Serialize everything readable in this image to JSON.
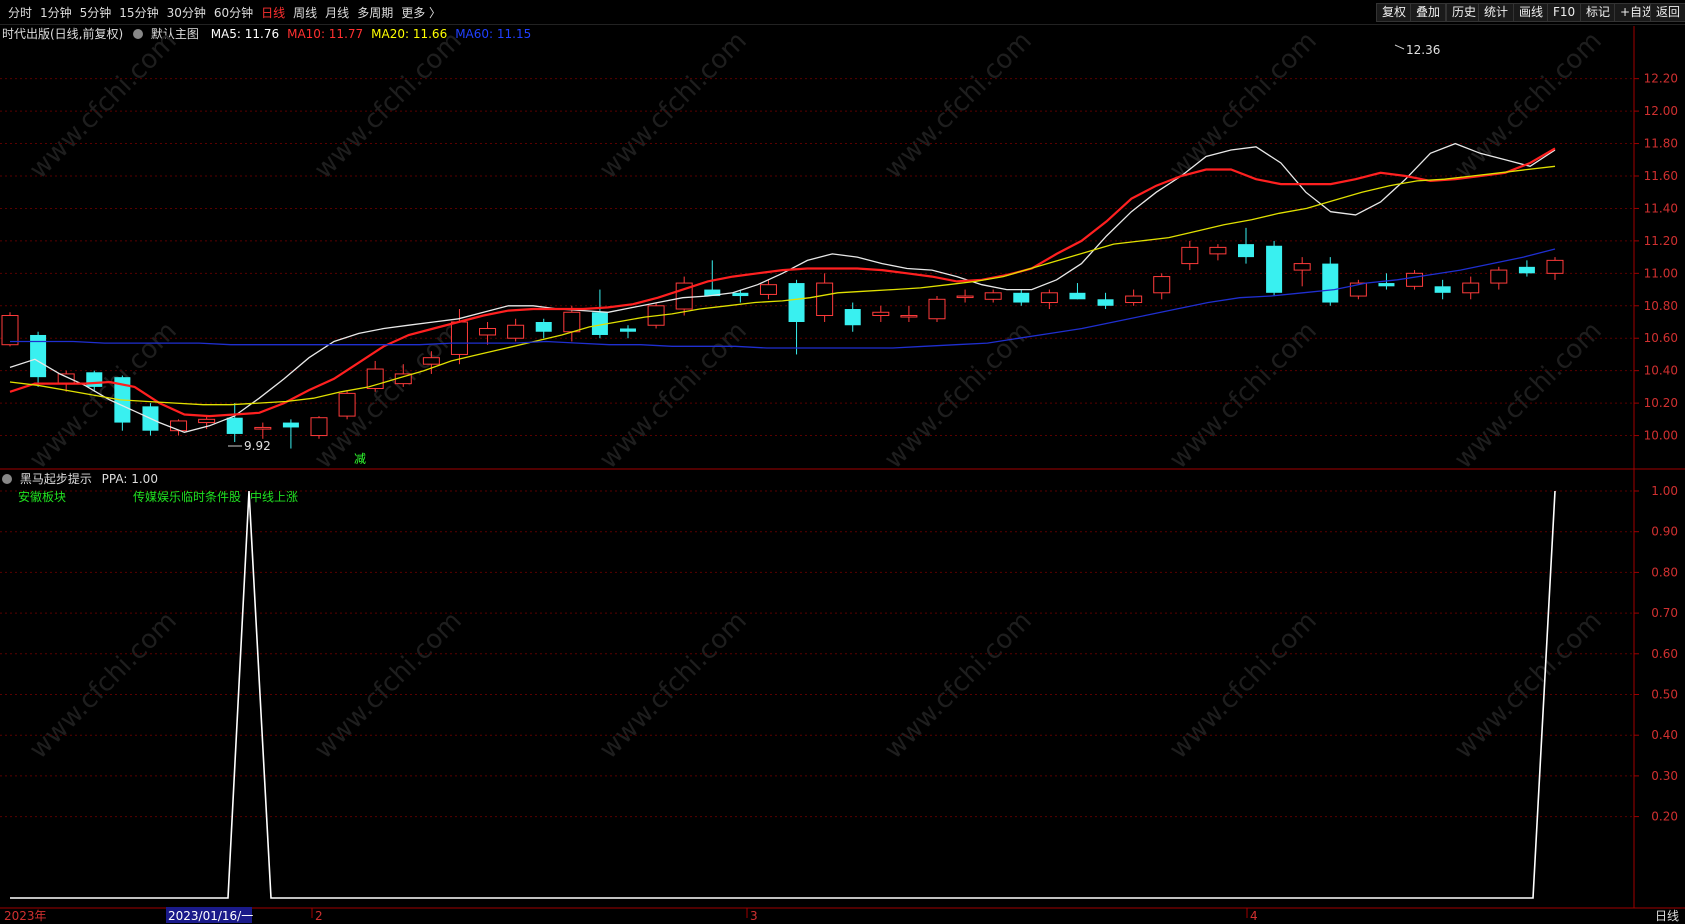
{
  "toolbar": {
    "left_tabs": [
      "分时",
      "1分钟",
      "5分钟",
      "15分钟",
      "30分钟",
      "60分钟",
      "日线",
      "周线",
      "月线",
      "多周期",
      "更多 〉"
    ],
    "active_tab": "日线",
    "right_buttons": [
      "复权",
      "叠加",
      "历史",
      "统计",
      "画线",
      "F10",
      "标记",
      "+自选",
      "返回"
    ]
  },
  "main_chart": {
    "stock_name": "时代出版(日线,前复权)",
    "indicator_label": "默认主图",
    "ma_labels": [
      {
        "text": "MA5: 11.76",
        "color": "#ffffff"
      },
      {
        "text": "MA10: 11.77",
        "color": "#ff3030"
      },
      {
        "text": "MA20: 11.66",
        "color": "#ffff00"
      },
      {
        "text": "MA60: 11.15",
        "color": "#2040ff"
      }
    ],
    "high_label": "12.36",
    "low_label": "9.92",
    "marker_text": "减",
    "y_ticks": [
      "12.20",
      "12.00",
      "11.80",
      "11.60",
      "11.40",
      "11.20",
      "11.00",
      "10.80",
      "10.60",
      "10.40",
      "10.20",
      "10.00"
    ],
    "y_range": [
      9.8,
      12.5
    ]
  },
  "sub_chart": {
    "title": "黑马起步提示",
    "value_label": "PPA: 1.00",
    "annotations": [
      "安徽板块",
      "传媒娱乐临时条件股",
      "中线上涨"
    ],
    "y_ticks": [
      "1.00",
      "0.90",
      "0.80",
      "0.70",
      "0.60",
      "0.50",
      "0.40",
      "0.30",
      "0.20"
    ]
  },
  "x_axis": {
    "labels": [
      "2023年",
      "2",
      "3",
      "4"
    ],
    "cursor_date": "2023/01/16/一",
    "period_label": "日线"
  },
  "watermark": "www.cfchi.com",
  "chart_data": {
    "type": "candlestick",
    "series": [
      {
        "name": "MA5",
        "values": [
          10.42,
          10.47,
          10.38,
          10.31,
          10.22,
          10.15,
          10.08,
          10.02,
          10.06,
          10.12,
          10.23,
          10.35,
          10.48,
          10.58,
          10.63,
          10.66,
          10.68,
          10.7,
          10.72,
          10.76,
          10.8,
          10.8,
          10.78,
          10.77,
          10.76,
          10.79,
          10.82,
          10.85,
          10.86,
          10.88,
          10.93,
          11.0,
          11.08,
          11.12,
          11.1,
          11.06,
          11.03,
          11.02,
          10.98,
          10.93,
          10.9,
          10.9,
          10.96,
          11.06,
          11.23,
          11.38,
          11.5,
          11.6,
          11.72,
          11.76,
          11.78,
          11.68,
          11.5,
          11.38,
          11.36,
          11.44,
          11.58,
          11.74,
          11.8,
          11.74,
          11.7,
          11.66,
          11.76
        ]
      },
      {
        "name": "MA10",
        "values": [
          10.27,
          10.32,
          10.32,
          10.32,
          10.33,
          10.3,
          10.2,
          10.13,
          10.12,
          10.13,
          10.14,
          10.2,
          10.28,
          10.35,
          10.45,
          10.55,
          10.62,
          10.66,
          10.7,
          10.74,
          10.77,
          10.78,
          10.78,
          10.78,
          10.79,
          10.81,
          10.85,
          10.9,
          10.95,
          10.98,
          11.0,
          11.02,
          11.03,
          11.03,
          11.03,
          11.02,
          11.0,
          10.98,
          10.95,
          10.96,
          10.99,
          11.03,
          11.12,
          11.2,
          11.32,
          11.46,
          11.54,
          11.6,
          11.64,
          11.64,
          11.58,
          11.55,
          11.55,
          11.55,
          11.58,
          11.62,
          11.6,
          11.57,
          11.58,
          11.6,
          11.62,
          11.68,
          11.77
        ]
      },
      {
        "name": "MA20",
        "values": [
          10.33,
          10.31,
          10.28,
          10.25,
          10.22,
          10.21,
          10.2,
          10.19,
          10.19,
          10.2,
          10.21,
          10.23,
          10.27,
          10.3,
          10.35,
          10.4,
          10.46,
          10.5,
          10.54,
          10.58,
          10.62,
          10.67,
          10.7,
          10.73,
          10.75,
          10.78,
          10.8,
          10.82,
          10.83,
          10.85,
          10.88,
          10.89,
          10.9,
          10.91,
          10.93,
          10.95,
          10.98,
          11.03,
          11.08,
          11.13,
          11.18,
          11.2,
          11.22,
          11.26,
          11.3,
          11.33,
          11.37,
          11.4,
          11.45,
          11.5,
          11.54,
          11.57,
          11.58,
          11.6,
          11.62,
          11.64,
          11.66
        ]
      },
      {
        "name": "MA60",
        "values": [
          10.58,
          10.58,
          10.58,
          10.57,
          10.57,
          10.57,
          10.57,
          10.56,
          10.56,
          10.56,
          10.56,
          10.56,
          10.56,
          10.56,
          10.57,
          10.57,
          10.57,
          10.58,
          10.57,
          10.56,
          10.56,
          10.55,
          10.55,
          10.55,
          10.54,
          10.54,
          10.54,
          10.54,
          10.54,
          10.55,
          10.56,
          10.57,
          10.6,
          10.63,
          10.66,
          10.7,
          10.74,
          10.78,
          10.82,
          10.85,
          10.86,
          10.88,
          10.9,
          10.94,
          10.96,
          10.99,
          11.02,
          11.06,
          11.1,
          11.15
        ]
      },
      {
        "name": "PPA",
        "values": [
          0,
          0,
          0,
          0,
          0,
          0,
          0,
          0,
          0,
          0,
          0,
          1,
          0,
          0,
          0,
          0,
          0,
          0,
          0,
          0,
          0,
          0,
          0,
          0,
          0,
          0,
          0,
          0,
          0,
          0,
          0,
          0,
          0,
          0,
          0,
          0,
          0,
          0,
          0,
          0,
          0,
          0,
          0,
          0,
          0,
          0,
          0,
          0,
          0,
          0,
          0,
          0,
          0,
          0,
          0,
          0,
          0,
          0,
          0,
          0,
          0,
          0,
          0,
          0,
          0,
          0,
          0,
          0,
          0,
          0,
          1
        ]
      }
    ],
    "candles": [
      {
        "o": 10.56,
        "h": 10.76,
        "l": 10.55,
        "c": 10.74
      },
      {
        "o": 10.62,
        "h": 10.64,
        "l": 10.3,
        "c": 10.36
      },
      {
        "o": 10.32,
        "h": 10.4,
        "l": 10.27,
        "c": 10.38
      },
      {
        "o": 10.39,
        "h": 10.4,
        "l": 10.27,
        "c": 10.3
      },
      {
        "o": 10.36,
        "h": 10.37,
        "l": 10.03,
        "c": 10.08
      },
      {
        "o": 10.18,
        "h": 10.2,
        "l": 10.0,
        "c": 10.03
      },
      {
        "o": 10.03,
        "h": 10.1,
        "l": 10.0,
        "c": 10.09
      },
      {
        "o": 10.08,
        "h": 10.12,
        "l": 10.04,
        "c": 10.1
      },
      {
        "o": 10.11,
        "h": 10.2,
        "l": 9.96,
        "c": 10.01
      },
      {
        "o": 10.04,
        "h": 10.08,
        "l": 9.98,
        "c": 10.05
      },
      {
        "o": 10.08,
        "h": 10.1,
        "l": 9.92,
        "c": 10.05
      },
      {
        "o": 10.0,
        "h": 10.12,
        "l": 9.98,
        "c": 10.11
      },
      {
        "o": 10.12,
        "h": 10.28,
        "l": 10.1,
        "c": 10.26
      },
      {
        "o": 10.29,
        "h": 10.46,
        "l": 10.27,
        "c": 10.41
      },
      {
        "o": 10.32,
        "h": 10.44,
        "l": 10.3,
        "c": 10.38
      },
      {
        "o": 10.44,
        "h": 10.52,
        "l": 10.38,
        "c": 10.48
      },
      {
        "o": 10.5,
        "h": 10.78,
        "l": 10.44,
        "c": 10.7
      },
      {
        "o": 10.62,
        "h": 10.7,
        "l": 10.56,
        "c": 10.66
      },
      {
        "o": 10.6,
        "h": 10.72,
        "l": 10.58,
        "c": 10.68
      },
      {
        "o": 10.7,
        "h": 10.72,
        "l": 10.6,
        "c": 10.64
      },
      {
        "o": 10.64,
        "h": 10.8,
        "l": 10.58,
        "c": 10.76
      },
      {
        "o": 10.76,
        "h": 10.9,
        "l": 10.6,
        "c": 10.62
      },
      {
        "o": 10.66,
        "h": 10.68,
        "l": 10.6,
        "c": 10.64
      },
      {
        "o": 10.68,
        "h": 10.82,
        "l": 10.66,
        "c": 10.8
      },
      {
        "o": 10.78,
        "h": 10.98,
        "l": 10.74,
        "c": 10.94
      },
      {
        "o": 10.9,
        "h": 11.08,
        "l": 10.86,
        "c": 10.86
      },
      {
        "o": 10.88,
        "h": 10.9,
        "l": 10.82,
        "c": 10.86
      },
      {
        "o": 10.87,
        "h": 10.96,
        "l": 10.84,
        "c": 10.93
      },
      {
        "o": 10.94,
        "h": 10.96,
        "l": 10.5,
        "c": 10.7
      },
      {
        "o": 10.74,
        "h": 11.0,
        "l": 10.7,
        "c": 10.94
      },
      {
        "o": 10.78,
        "h": 10.82,
        "l": 10.64,
        "c": 10.68
      },
      {
        "o": 10.74,
        "h": 10.8,
        "l": 10.7,
        "c": 10.76
      },
      {
        "o": 10.74,
        "h": 10.8,
        "l": 10.7,
        "c": 10.74
      },
      {
        "o": 10.72,
        "h": 10.86,
        "l": 10.7,
        "c": 10.84
      },
      {
        "o": 10.86,
        "h": 10.9,
        "l": 10.82,
        "c": 10.86
      },
      {
        "o": 10.84,
        "h": 10.9,
        "l": 10.82,
        "c": 10.88
      },
      {
        "o": 10.88,
        "h": 10.9,
        "l": 10.8,
        "c": 10.82
      },
      {
        "o": 10.82,
        "h": 10.9,
        "l": 10.78,
        "c": 10.88
      },
      {
        "o": 10.88,
        "h": 10.94,
        "l": 10.84,
        "c": 10.84
      },
      {
        "o": 10.84,
        "h": 10.88,
        "l": 10.78,
        "c": 10.8
      },
      {
        "o": 10.82,
        "h": 10.9,
        "l": 10.8,
        "c": 10.86
      },
      {
        "o": 10.88,
        "h": 11.0,
        "l": 10.84,
        "c": 10.98
      },
      {
        "o": 11.06,
        "h": 11.2,
        "l": 11.02,
        "c": 11.16
      },
      {
        "o": 11.12,
        "h": 11.18,
        "l": 11.08,
        "c": 11.16
      },
      {
        "o": 11.18,
        "h": 11.28,
        "l": 11.06,
        "c": 11.1
      },
      {
        "o": 11.17,
        "h": 11.2,
        "l": 10.86,
        "c": 10.88
      },
      {
        "o": 11.02,
        "h": 11.1,
        "l": 10.92,
        "c": 11.06
      },
      {
        "o": 11.06,
        "h": 11.1,
        "l": 10.8,
        "c": 10.82
      },
      {
        "o": 10.86,
        "h": 10.96,
        "l": 10.84,
        "c": 10.94
      },
      {
        "o": 10.94,
        "h": 11.0,
        "l": 10.9,
        "c": 10.92
      },
      {
        "o": 10.92,
        "h": 11.02,
        "l": 10.9,
        "c": 11.0
      },
      {
        "o": 10.92,
        "h": 10.96,
        "l": 10.84,
        "c": 10.88
      },
      {
        "o": 10.88,
        "h": 10.98,
        "l": 10.84,
        "c": 10.94
      },
      {
        "o": 10.94,
        "h": 11.04,
        "l": 10.9,
        "c": 11.02
      },
      {
        "o": 11.04,
        "h": 11.08,
        "l": 10.98,
        "c": 11.0
      },
      {
        "o": 11.0,
        "h": 11.1,
        "l": 10.96,
        "c": 11.08
      }
    ]
  }
}
